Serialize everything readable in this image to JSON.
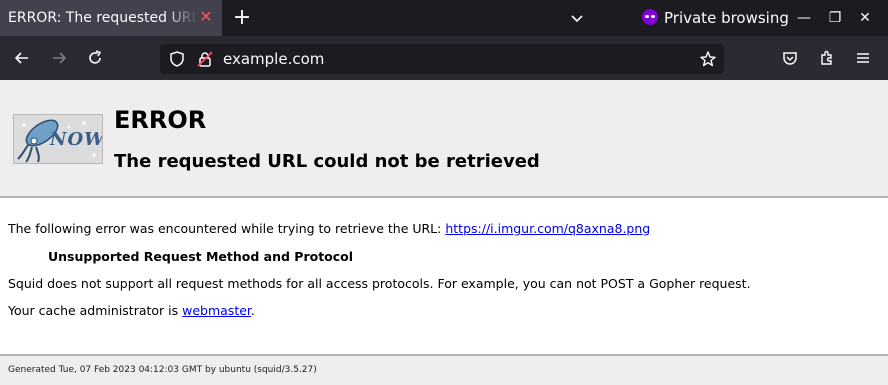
{
  "browser": {
    "tab": {
      "title": "ERROR: The requested URL could not be retrieved",
      "close_icon": "close-icon"
    },
    "new_tab_label": "+",
    "private_label": "Private browsing",
    "url": "example.com",
    "window_controls": {
      "minimize": "—",
      "restore": "❐",
      "close": "✕"
    }
  },
  "page": {
    "logo_text": "NOW",
    "title": "ERROR",
    "subtitle": "The requested URL could not be retrieved",
    "intro_text": "The following error was encountered while trying to retrieve the URL: ",
    "intro_link": "https://i.imgur.com/q8axna8.png",
    "error_heading": "Unsupported Request Method and Protocol",
    "error_detail": "Squid does not support all request methods for all access protocols. For example, you can not POST a Gopher request.",
    "admin_text": "Your cache administrator is ",
    "admin_link": "webmaster",
    "admin_suffix": ".",
    "footer": "Generated Tue, 07 Feb 2023 04:12:03 GMT by ubuntu (squid/3.5.27)"
  },
  "colors": {
    "tabbar": "#1c1b22",
    "navbar": "#2b2a33",
    "private_accent": "#8000d7",
    "link": "#0000ee",
    "page_header_bg": "#eeeeee"
  }
}
